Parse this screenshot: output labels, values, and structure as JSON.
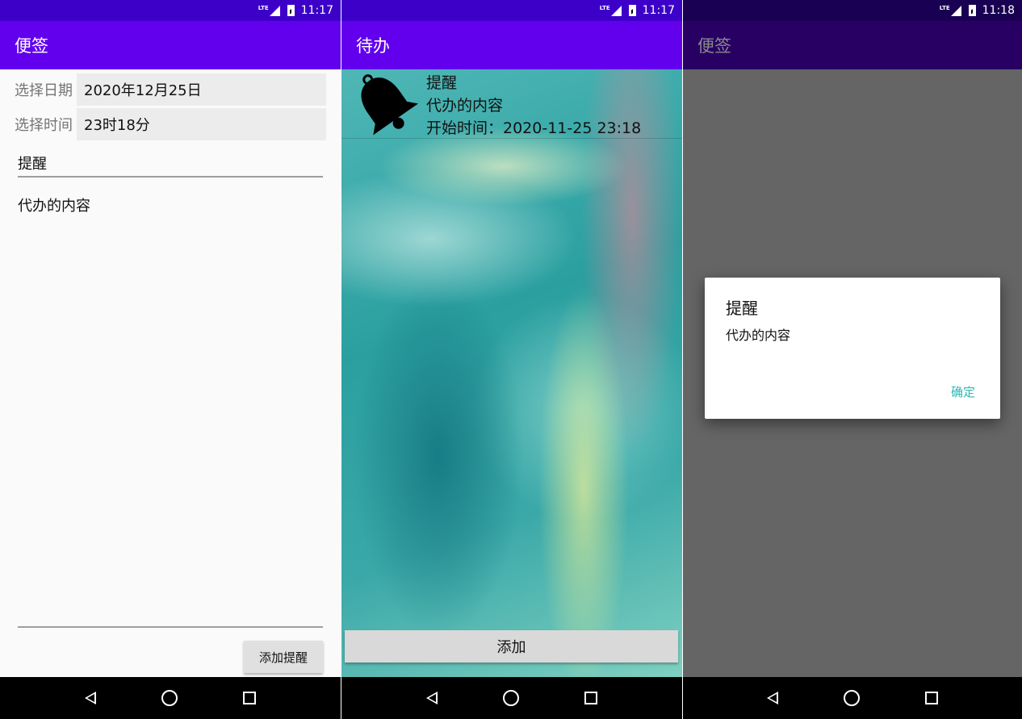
{
  "colors": {
    "primary": "#6200ee",
    "primary_dimmed": "#280064",
    "statusbar": "#3c00c8",
    "statusbar_dimmed": "#1a0052",
    "accent": "#2bb8b4"
  },
  "panel1": {
    "status_time": "11:17",
    "app_title": "便签",
    "date_label": "选择日期",
    "date_value": "2020年12月25日",
    "time_label": "选择时间",
    "time_value": "23时18分",
    "title_field": "提醒",
    "content_field": "代办的内容",
    "add_reminder_button": "添加提醒"
  },
  "panel2": {
    "status_time": "11:17",
    "app_title": "待办",
    "todo": {
      "icon": "bell-icon",
      "title": "提醒",
      "content": "代办的内容",
      "start_time": "开始时间：2020-11-25 23:18"
    },
    "add_button": "添加"
  },
  "panel3": {
    "status_time": "11:18",
    "app_title": "便签",
    "dialog": {
      "title": "提醒",
      "message": "代办的内容",
      "ok_button": "确定"
    }
  },
  "status_icons": {
    "network": "LTE"
  }
}
